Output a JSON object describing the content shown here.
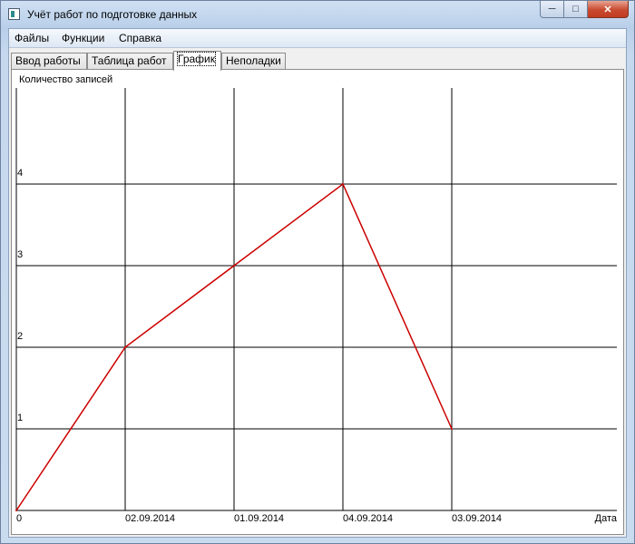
{
  "window": {
    "title": "Учёт работ по подготовке данных"
  },
  "menu": {
    "items": [
      "Файлы",
      "Функции",
      "Справка"
    ]
  },
  "tabs": [
    {
      "label": "Ввод работы",
      "active": false
    },
    {
      "label": "Таблица работ",
      "active": false
    },
    {
      "label": "График",
      "active": true
    },
    {
      "label": "Неполадки",
      "active": false
    }
  ],
  "chart_data": {
    "type": "line",
    "ylabel": "Количество записей",
    "xlabel": "Дата",
    "categories": [
      "0",
      "02.09.2014",
      "01.09.2014",
      "04.09.2014",
      "03.09.2014"
    ],
    "values": [
      0,
      2,
      3,
      4,
      1
    ],
    "yticks": [
      1,
      2,
      3,
      4
    ],
    "ylim": [
      0,
      4.4
    ],
    "grid": true,
    "line_color": "#cc0000"
  }
}
